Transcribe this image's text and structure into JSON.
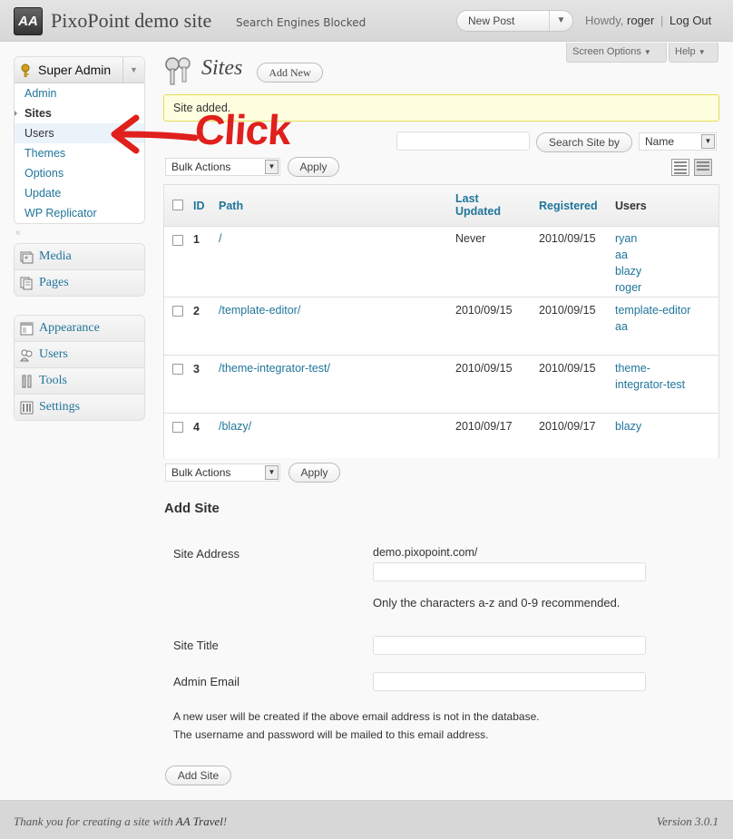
{
  "header": {
    "logo_text": "AA",
    "site_title": "PixoPoint demo site",
    "search_engines": "Search Engines Blocked",
    "favorite_action": "New Post",
    "howdy": "Howdy,",
    "username": "roger",
    "separator": "|",
    "logout": "Log Out"
  },
  "screen_meta": {
    "screen_options": "Screen Options",
    "help": "Help"
  },
  "sidebar": {
    "super_admin": "Super Admin",
    "submenu": [
      {
        "label": "Admin"
      },
      {
        "label": "Sites",
        "current": true
      },
      {
        "label": "Users"
      },
      {
        "label": "Themes"
      },
      {
        "label": "Options"
      },
      {
        "label": "Update"
      },
      {
        "label": "WP Replicator"
      }
    ],
    "group2": [
      {
        "label": "Media",
        "icon": "media-icon"
      },
      {
        "label": "Pages",
        "icon": "pages-icon"
      }
    ],
    "group3": [
      {
        "label": "Appearance",
        "icon": "appearance-icon"
      },
      {
        "label": "Users",
        "icon": "users-icon"
      },
      {
        "label": "Tools",
        "icon": "tools-icon"
      },
      {
        "label": "Settings",
        "icon": "settings-icon"
      }
    ],
    "collapse_glyph": "«"
  },
  "page": {
    "title": "Sites",
    "add_new": "Add New",
    "notice": "Site added."
  },
  "search": {
    "value": "",
    "button": "Search Site by",
    "field": "Name"
  },
  "bulk": {
    "label": "Bulk Actions",
    "apply": "Apply"
  },
  "table": {
    "columns": {
      "id": "ID",
      "path": "Path",
      "last_updated": [
        "Last",
        "Updated"
      ],
      "registered": "Registered",
      "users": "Users"
    },
    "rows": [
      {
        "id": "1",
        "path": "/",
        "last_updated": "Never",
        "registered": "2010/09/15",
        "users": [
          "ryan",
          "aa",
          "blazy",
          "roger"
        ]
      },
      {
        "id": "2",
        "path": "/template-editor/",
        "last_updated": "2010/09/15",
        "registered": "2010/09/15",
        "users": [
          "template-editor",
          "aa"
        ]
      },
      {
        "id": "3",
        "path": "/theme-integrator-test/",
        "last_updated": "2010/09/15",
        "registered": "2010/09/15",
        "users": [
          "theme-",
          "integrator-test"
        ]
      },
      {
        "id": "4",
        "path": "/blazy/",
        "last_updated": "2010/09/17",
        "registered": "2010/09/17",
        "users": [
          "blazy"
        ]
      }
    ]
  },
  "add_site": {
    "heading": "Add Site",
    "site_address_label": "Site Address",
    "domain": "demo.pixopoint.com/",
    "address_value": "",
    "hint": "Only the characters a-z and 0-9 recommended.",
    "site_title_label": "Site Title",
    "site_title_value": "",
    "admin_email_label": "Admin Email",
    "admin_email_value": "",
    "note_line1": "A new user will be created if the above email address is not in the database.",
    "note_line2": "The username and password will be mailed to this email address.",
    "submit": "Add Site"
  },
  "footer": {
    "thanks_prefix": "Thank you for creating a site with ",
    "thanks_link": "AA Travel",
    "thanks_suffix": "!",
    "version": "Version 3.0.1"
  },
  "annotation": {
    "text": "Click",
    "color": "#e0201c"
  },
  "colors": {
    "link": "#21759b",
    "notice_bg": "#ffffe0",
    "notice_border": "#e6db55",
    "annotation": "#e0201c"
  }
}
